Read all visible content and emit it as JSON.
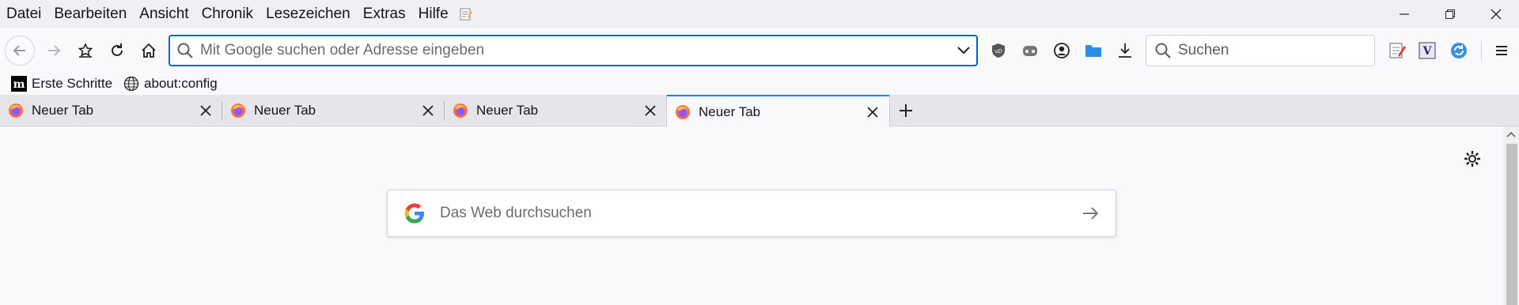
{
  "menubar": {
    "items": [
      {
        "label": "Datei"
      },
      {
        "label": "Bearbeiten"
      },
      {
        "label": "Ansicht"
      },
      {
        "label": "Chronik"
      },
      {
        "label": "Lesezeichen"
      },
      {
        "label": "Extras"
      },
      {
        "label": "Hilfe"
      }
    ],
    "extra_icon": "notepad-icon"
  },
  "navbar": {
    "urlbar_placeholder": "Mit Google suchen oder Adresse eingeben",
    "search_placeholder": "Suchen",
    "extensions": [
      "ublock-icon",
      "privacy-badger-icon",
      "account-icon",
      "folder-icon",
      "download-icon"
    ],
    "right_extensions": [
      "notes-edit-icon",
      "v-extension-icon",
      "sync-icon"
    ]
  },
  "bookmarks": [
    {
      "label": "Erste Schritte",
      "icon": "medium-logo-icon"
    },
    {
      "label": "about:config",
      "icon": "globe-icon"
    }
  ],
  "tabs": [
    {
      "label": "Neuer Tab",
      "active": false
    },
    {
      "label": "Neuer Tab",
      "active": false
    },
    {
      "label": "Neuer Tab",
      "active": false
    },
    {
      "label": "Neuer Tab",
      "active": true
    }
  ],
  "content": {
    "websearch_placeholder": "Das Web durchsuchen"
  },
  "colors": {
    "accent": "#0061e0",
    "tab_active_border": "#0a84ff",
    "menubar_bg": "#f0f0f4",
    "tabstrip_bg": "#e5e5ea"
  }
}
